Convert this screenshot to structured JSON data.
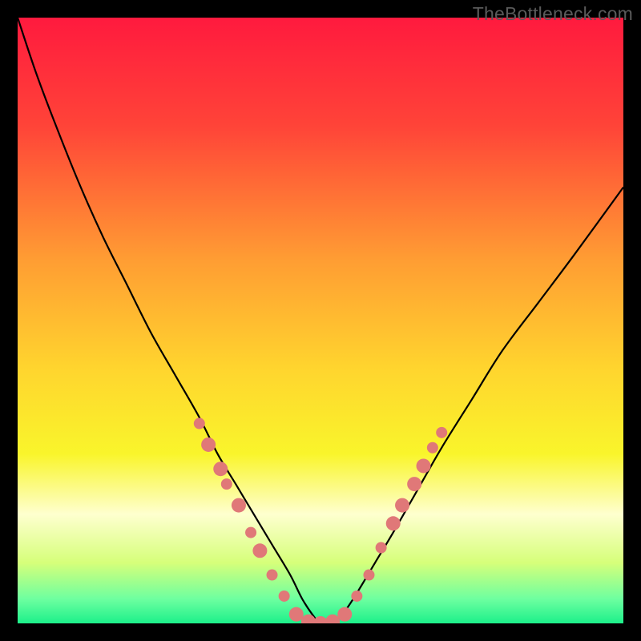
{
  "watermark": "TheBottleneck.com",
  "chart_data": {
    "type": "line",
    "title": "",
    "xlabel": "",
    "ylabel": "",
    "xlim": [
      0,
      100
    ],
    "ylim": [
      0,
      100
    ],
    "background_gradient": {
      "stops": [
        {
          "offset": 0,
          "color": "#ff1a3e"
        },
        {
          "offset": 18,
          "color": "#ff4438"
        },
        {
          "offset": 40,
          "color": "#ff9d33"
        },
        {
          "offset": 58,
          "color": "#ffd52e"
        },
        {
          "offset": 72,
          "color": "#f9f52b"
        },
        {
          "offset": 82,
          "color": "#feffcf"
        },
        {
          "offset": 90,
          "color": "#d6ff7a"
        },
        {
          "offset": 96,
          "color": "#6dffa0"
        },
        {
          "offset": 100,
          "color": "#1cf08a"
        }
      ]
    },
    "series": [
      {
        "name": "bottleneck-curve",
        "x": [
          0,
          3,
          6,
          10,
          14,
          18,
          22,
          26,
          30,
          33,
          36,
          39,
          42,
          45,
          47,
          49,
          50,
          52,
          54,
          56,
          59,
          62,
          66,
          70,
          75,
          80,
          86,
          92,
          100
        ],
        "y": [
          100,
          91,
          83,
          73,
          64,
          56,
          48,
          41,
          34,
          28,
          23,
          18,
          13,
          8,
          4,
          1,
          0,
          0,
          2,
          5,
          10,
          15,
          22,
          29,
          37,
          45,
          53,
          61,
          72
        ]
      }
    ],
    "markers": [
      {
        "x": 30.0,
        "y": 33.0,
        "r": 7
      },
      {
        "x": 31.5,
        "y": 29.5,
        "r": 9
      },
      {
        "x": 33.5,
        "y": 25.5,
        "r": 9
      },
      {
        "x": 34.5,
        "y": 23.0,
        "r": 7
      },
      {
        "x": 36.5,
        "y": 19.5,
        "r": 9
      },
      {
        "x": 38.5,
        "y": 15.0,
        "r": 7
      },
      {
        "x": 40.0,
        "y": 12.0,
        "r": 9
      },
      {
        "x": 42.0,
        "y": 8.0,
        "r": 7
      },
      {
        "x": 44.0,
        "y": 4.5,
        "r": 7
      },
      {
        "x": 46.0,
        "y": 1.5,
        "r": 9
      },
      {
        "x": 48.0,
        "y": 0.3,
        "r": 9
      },
      {
        "x": 50.0,
        "y": 0.0,
        "r": 9
      },
      {
        "x": 52.0,
        "y": 0.3,
        "r": 9
      },
      {
        "x": 54.0,
        "y": 1.5,
        "r": 9
      },
      {
        "x": 56.0,
        "y": 4.5,
        "r": 7
      },
      {
        "x": 58.0,
        "y": 8.0,
        "r": 7
      },
      {
        "x": 60.0,
        "y": 12.5,
        "r": 7
      },
      {
        "x": 62.0,
        "y": 16.5,
        "r": 9
      },
      {
        "x": 63.5,
        "y": 19.5,
        "r": 9
      },
      {
        "x": 65.5,
        "y": 23.0,
        "r": 9
      },
      {
        "x": 67.0,
        "y": 26.0,
        "r": 9
      },
      {
        "x": 68.5,
        "y": 29.0,
        "r": 7
      },
      {
        "x": 70.0,
        "y": 31.5,
        "r": 7
      }
    ],
    "marker_color": "#e07878",
    "curve_color": "#000000"
  }
}
